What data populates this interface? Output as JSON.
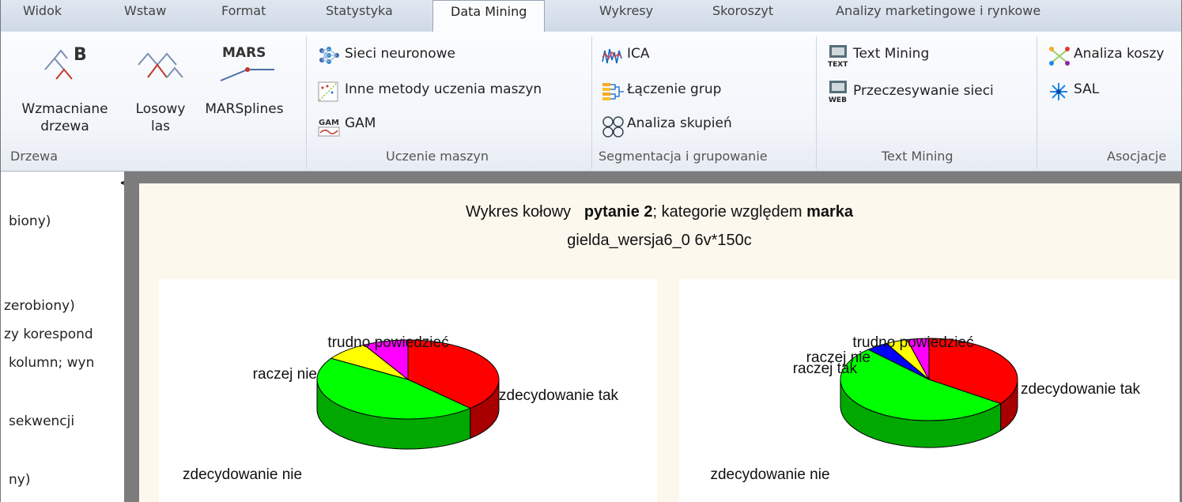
{
  "tabs": [
    "Widok",
    "Wstaw",
    "Format",
    "Statystyka",
    "Data Mining",
    "Wykresy",
    "Skoroszyt",
    "Analizy marketingowe i rynkowe"
  ],
  "active_tab": "Data Mining",
  "ribbon": {
    "drzewa": {
      "label": "Drzewa",
      "buttons": [
        {
          "line1": "Wzmacniane",
          "line2": "drzewa"
        },
        {
          "line1": "Losowy",
          "line2": "las"
        },
        {
          "line1": "MARSplines",
          "line2": ""
        }
      ],
      "mars_badge": "MARS",
      "b_badge": "B"
    },
    "uczenie": {
      "label": "Uczenie maszyn",
      "items": [
        "Sieci neuronowe",
        "Inne metody uczenia maszyn",
        "GAM"
      ],
      "gam_badge": "GAM"
    },
    "segmentacja": {
      "label": "Segmentacja i grupowanie",
      "items": [
        "ICA",
        "Łączenie grup",
        "Analiza skupień"
      ]
    },
    "textmining": {
      "label": "Text Mining",
      "items": [
        "Text Mining",
        "Przeczesywanie sieci"
      ],
      "badges": [
        "TEXT",
        "WEB"
      ]
    },
    "asocjacje": {
      "label": "Asocjacje",
      "items": [
        "Analiza koszy",
        "SAL"
      ]
    }
  },
  "left_panel": {
    "collapse": "<",
    "items": [
      "biony)",
      "zerobiony)",
      "zy korespond",
      "kolumn; wyn",
      "sekwencji",
      "ny)"
    ]
  },
  "chart": {
    "title_prefix": "Wykres kołowy",
    "title_bold1": "pytanie 2",
    "title_mid": "; kategorie względem ",
    "title_bold2": "marka",
    "subtitle": "gielda_wersja6_0 6v*150c"
  },
  "chart_data": [
    {
      "type": "pie",
      "slices": [
        {
          "label": "zdecydowanie tak",
          "value": 38.0,
          "color": "#ff0000"
        },
        {
          "label": "zdecydowanie nie",
          "value": 46.0,
          "color": "#00ff00"
        },
        {
          "label": "raczej nie",
          "value": 8.0,
          "color": "#ffff00"
        },
        {
          "label": "trudno powiedzieć",
          "value": 8.0,
          "color": "#ff00ff"
        }
      ]
    },
    {
      "type": "pie",
      "slices": [
        {
          "label": "zdecydowanie tak",
          "value": 35.0,
          "color": "#ff0000"
        },
        {
          "label": "zdecydowanie nie",
          "value": 53.0,
          "color": "#00ff00"
        },
        {
          "label": "raczej tak",
          "value": 4.0,
          "color": "#0000ff"
        },
        {
          "label": "raczej nie",
          "value": 4.0,
          "color": "#ffff00"
        },
        {
          "label": "trudno powiedzieć",
          "value": 4.0,
          "color": "#ff00ff"
        }
      ]
    }
  ]
}
